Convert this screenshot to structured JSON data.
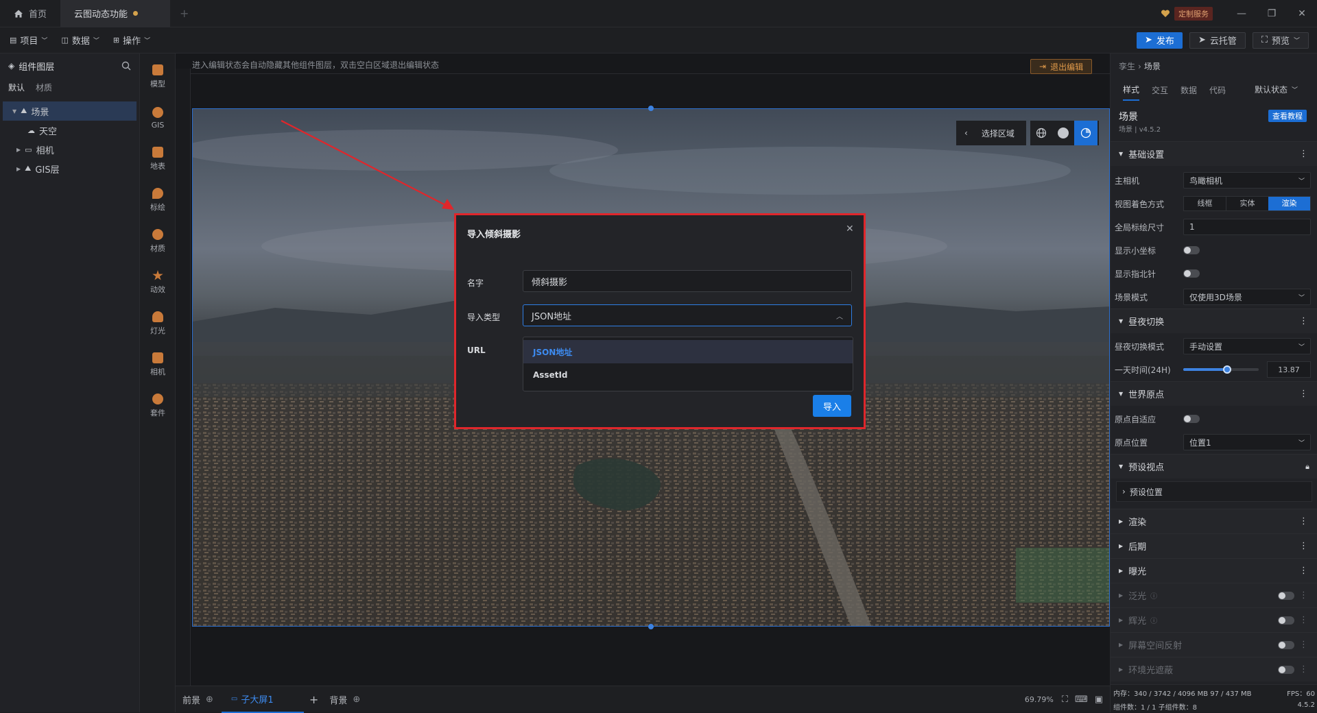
{
  "titlebar": {
    "home_tab": "首页",
    "project_tab": "云图动态功能",
    "custom_service": "定制服务"
  },
  "toolbar": {
    "menus": [
      "项目",
      "数据",
      "操作"
    ],
    "publish": "发布",
    "cloud_host": "云托管",
    "preview": "预览"
  },
  "left_panel": {
    "title": "组件图层",
    "tabs": [
      "默认",
      "材质"
    ],
    "tree": [
      {
        "label": "场景",
        "level": 0,
        "selected": true
      },
      {
        "label": "天空",
        "level": 1
      },
      {
        "label": "相机",
        "level": 1
      },
      {
        "label": "GIS层",
        "level": 1
      }
    ]
  },
  "rail": [
    "模型",
    "GIS",
    "地表",
    "标绘",
    "材质",
    "动效",
    "灯光",
    "相机",
    "套件"
  ],
  "editor": {
    "notice": "进入编辑状态会自动隐藏其他组件图层，双击空白区域退出编辑状态",
    "exit_edit": "退出编辑",
    "select_region": "选择区域"
  },
  "bottom": {
    "foreground": "前景",
    "sub_screen": "子大屏1",
    "background": "背景",
    "zoom": "69.79%"
  },
  "right_panel": {
    "breadcrumb": [
      "孪生",
      "场景"
    ],
    "tabs": [
      "样式",
      "交互",
      "数据",
      "代码"
    ],
    "state": "默认状态",
    "title": "场景",
    "version": "场景 | v4.5.2",
    "tutorial": "查看教程",
    "sections": {
      "basic": "基础设置",
      "daynight": "昼夜切换",
      "world_origin": "世界原点",
      "preset": "预设视点",
      "preset_pos": "预设位置",
      "render": "渲染",
      "post": "后期",
      "exposure": "曝光",
      "bloom": "泛光",
      "glow": "辉光",
      "ssr": "屏幕空间反射",
      "ao": "环境光遮蔽"
    },
    "fields": {
      "main_camera_label": "主相机",
      "main_camera": "鸟瞰相机",
      "view_color_label": "视图着色方式",
      "view_modes": [
        "线框",
        "实体",
        "渲染"
      ],
      "global_scale_label": "全局标绘尺寸",
      "global_scale": "1",
      "show_axis_label": "显示小坐标",
      "show_compass_label": "显示指北针",
      "scene_mode_label": "场景模式",
      "scene_mode": "仅使用3D场景",
      "daynight_mode_label": "昼夜切换模式",
      "daynight_mode": "手动设置",
      "time_label": "一天时间(24H)",
      "time_value": "13.87",
      "time_fraction": 0.578,
      "auto_origin_label": "原点自适应",
      "origin_pos_label": "原点位置",
      "origin_pos": "位置1"
    }
  },
  "status": {
    "memory": "内存：340 / 3742 / 4096 MB  97 / 437 MB",
    "fps": "FPS：60",
    "counts": "组件数：1 / 1   子组件数：8",
    "version": "4.5.2"
  },
  "modal": {
    "title": "导入倾斜摄影",
    "name_label": "名字",
    "name_value": "倾斜摄影",
    "type_label": "导入类型",
    "type_value": "JSON地址",
    "url_label": "URL",
    "options": [
      "JSON地址",
      "AssetId"
    ],
    "import_button": "导入"
  },
  "colors": {
    "accent": "#1c6ed4",
    "highlight_border": "#e0262b",
    "arrow": "#e0262b"
  }
}
